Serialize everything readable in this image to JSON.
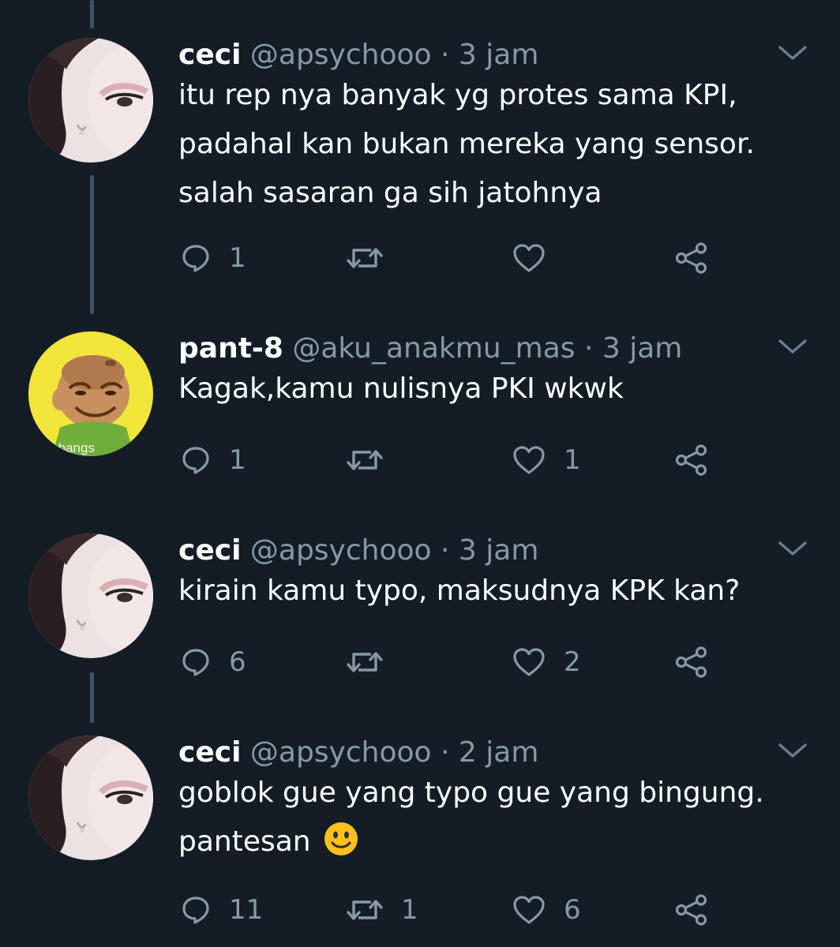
{
  "colors": {
    "background": "#141d26",
    "primary_text": "#ffffff",
    "secondary_text": "#8899a6",
    "thread_line": "#3d5466"
  },
  "tweets": [
    {
      "name": "ceci",
      "handle": "@apsychooo",
      "separator": "·",
      "time": "3 jam",
      "lines": [
        "itu rep nya banyak yg protes sama KPI,",
        "padahal kan bukan mereka yang sensor.",
        "salah sasaran ga sih jatohnya"
      ],
      "counts": {
        "reply": "1",
        "retweet": "",
        "like": ""
      },
      "avatar": "girl-avatar"
    },
    {
      "name": "pant-8",
      "handle": "@aku_anakmu_mas",
      "separator": "·",
      "time": "3 jam",
      "lines": [
        "Kagak,kamu nulisnya PKI wkwk"
      ],
      "counts": {
        "reply": "1",
        "retweet": "",
        "like": "1"
      },
      "avatar": "cartoon-avatar",
      "avatar_caption": "aa bangs"
    },
    {
      "name": "ceci",
      "handle": "@apsychooo",
      "separator": "·",
      "time": "3 jam",
      "lines": [
        "kirain kamu typo, maksudnya KPK kan?"
      ],
      "counts": {
        "reply": "6",
        "retweet": "",
        "like": "2"
      },
      "avatar": "girl-avatar"
    },
    {
      "name": "ceci",
      "handle": "@apsychooo",
      "separator": "·",
      "time": "2 jam",
      "lines": [
        "goblok gue yang typo gue yang bingung.",
        "pantesan"
      ],
      "emoji": "smiling-face",
      "counts": {
        "reply": "11",
        "retweet": "1",
        "like": "6"
      },
      "avatar": "girl-avatar"
    }
  ]
}
